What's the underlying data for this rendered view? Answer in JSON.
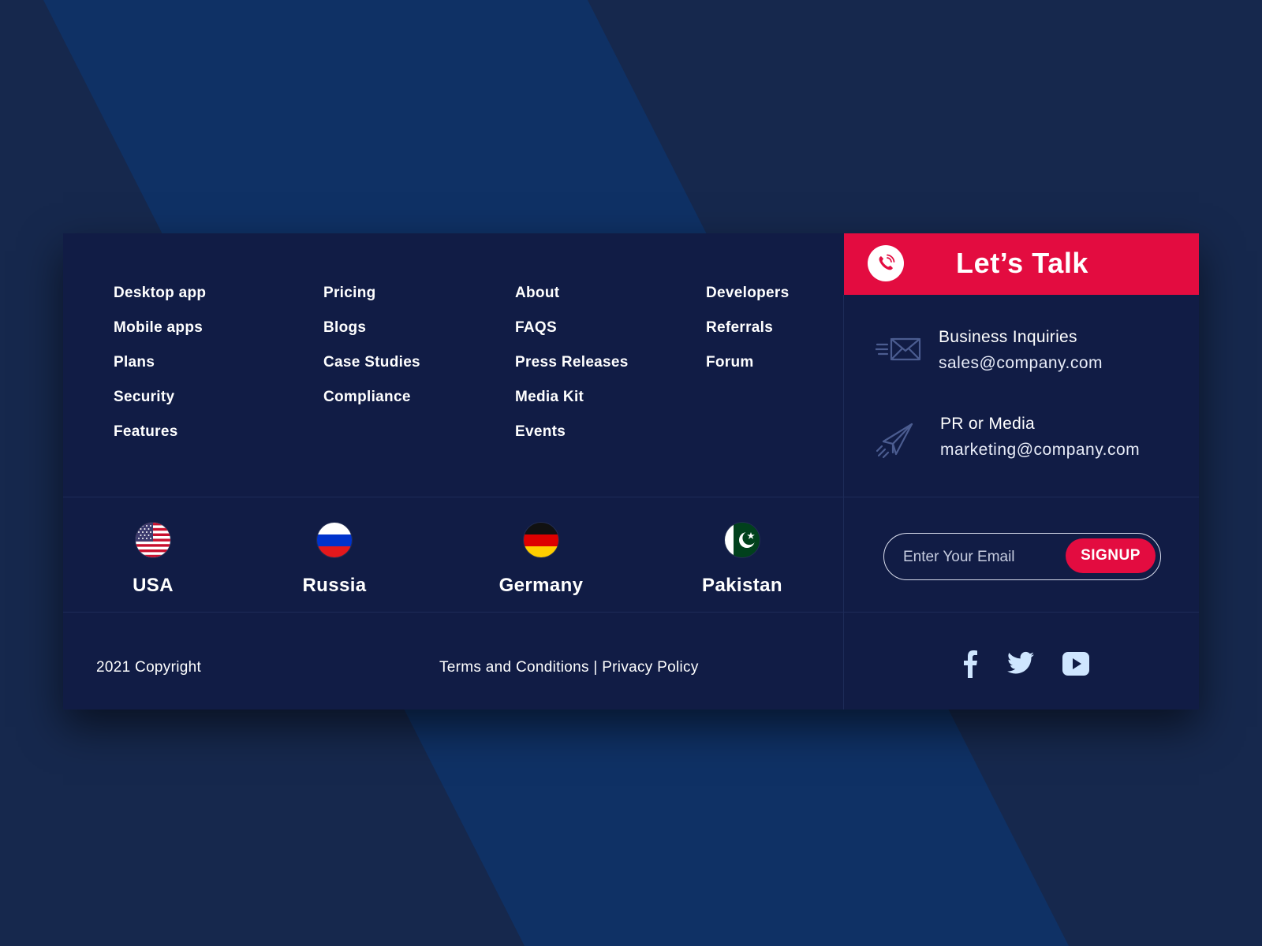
{
  "link_columns": [
    [
      "Desktop app",
      "Mobile apps",
      "Plans",
      "Security",
      "Features"
    ],
    [
      "Pricing",
      "Blogs",
      "Case Studies",
      "Compliance"
    ],
    [
      "About",
      "FAQS",
      "Press Releases",
      "Media Kit",
      "Events"
    ],
    [
      "Developers",
      "Referrals",
      "Forum"
    ]
  ],
  "countries": [
    {
      "name": "USA",
      "flag": "us-flag-icon"
    },
    {
      "name": "Russia",
      "flag": "russia-flag-icon"
    },
    {
      "name": "Germany",
      "flag": "germany-flag-icon"
    },
    {
      "name": "Pakistan",
      "flag": "pakistan-flag-icon"
    }
  ],
  "talk": {
    "title": "Let’s Talk",
    "icon": "phone-icon",
    "contacts": [
      {
        "label": "Business Inquiries",
        "email": "sales@company.com",
        "icon": "envelope-icon"
      },
      {
        "label": "PR or Media",
        "email": "marketing@company.com",
        "icon": "paper-plane-icon"
      }
    ]
  },
  "newsletter": {
    "placeholder": "Enter Your Email",
    "button": "SIGNUP"
  },
  "bottom": {
    "copyright": "2021  Copyright",
    "terms": "Terms and Conditions",
    "separator": "|",
    "privacy": "Privacy Policy"
  },
  "social": [
    "facebook-icon",
    "twitter-icon",
    "youtube-icon"
  ],
  "colors": {
    "background": "#16284d",
    "card": "#111c45",
    "accent": "#e30c40",
    "stripe": "#0f3165"
  }
}
